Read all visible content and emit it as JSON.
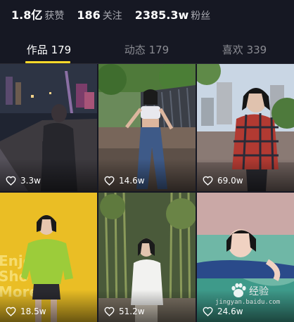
{
  "profile_stats": [
    {
      "value": "1.8亿",
      "label": "获赞"
    },
    {
      "value": "186",
      "label": "关注"
    },
    {
      "value": "2385.3w",
      "label": "粉丝"
    }
  ],
  "tabs": [
    {
      "label": "作品 179",
      "active": true
    },
    {
      "label": "动态 179",
      "active": false
    },
    {
      "label": "喜欢 339",
      "active": false
    }
  ],
  "videos": [
    {
      "likes": "3.3w"
    },
    {
      "likes": "14.6w"
    },
    {
      "likes": "69.0w"
    },
    {
      "likes": "18.5w"
    },
    {
      "likes": "51.2w"
    },
    {
      "likes": "24.6w"
    }
  ],
  "thumbnail_text": {
    "video_4": [
      "Enjo",
      "Sho",
      "More"
    ]
  },
  "watermark": {
    "brand": "经验",
    "url": "jingyan.baidu.com"
  },
  "colors": {
    "background": "#161823",
    "tab_indicator": "#fdd92a",
    "inactive_text": "#8a8b92"
  },
  "icons": {
    "like": "heart-outline-icon",
    "watermark": "baidu-paw-logo"
  }
}
